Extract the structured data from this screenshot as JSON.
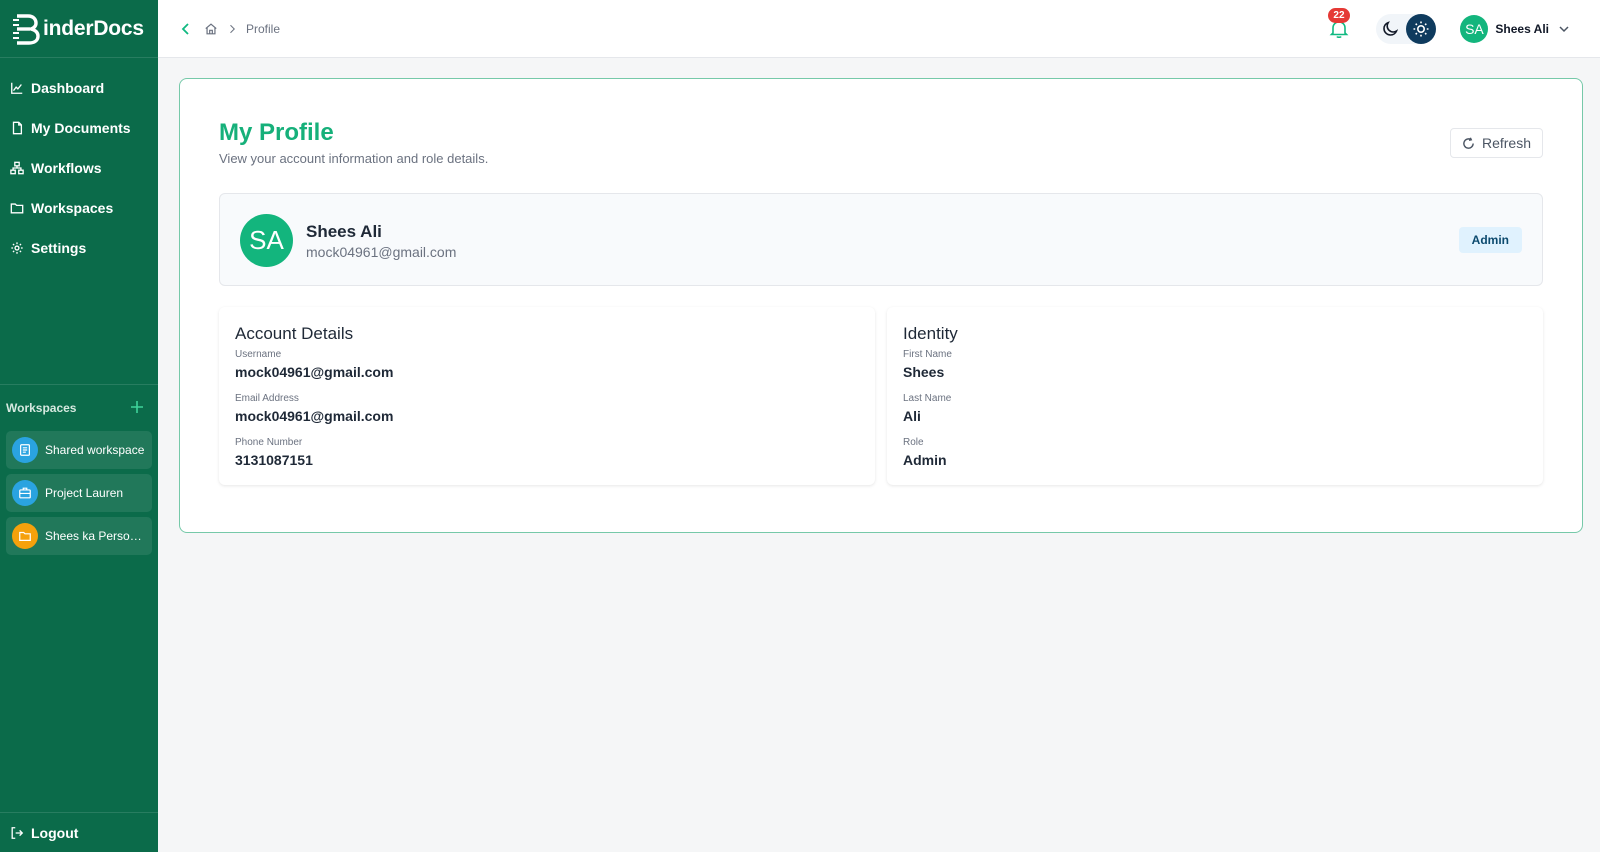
{
  "app": {
    "logo_letter": "B",
    "logo_text": "inderDocs"
  },
  "sidebar": {
    "nav": [
      {
        "label": "Dashboard",
        "icon": "chart-line-icon"
      },
      {
        "label": "My Documents",
        "icon": "file-icon"
      },
      {
        "label": "Workflows",
        "icon": "workflow-icon"
      },
      {
        "label": "Workspaces",
        "icon": "folder-icon"
      },
      {
        "label": "Settings",
        "icon": "gear-icon"
      }
    ],
    "workspaces_title": "Workspaces",
    "workspaces": [
      {
        "label": "Shared workspace",
        "color": "#2aa3e0"
      },
      {
        "label": "Project Lauren",
        "color": "#2aa3e0"
      },
      {
        "label": "Shees ka Personal",
        "color": "#f5a10c"
      }
    ],
    "logout_label": "Logout"
  },
  "header": {
    "breadcrumb_current": "Profile",
    "notification_count": "22",
    "user_initials": "SA",
    "user_name": "Shees Ali"
  },
  "profile": {
    "title": "My Profile",
    "subtitle": "View your account information and role details.",
    "refresh_label": "Refresh",
    "initials": "SA",
    "name": "Shees Ali",
    "email": "mock04961@gmail.com",
    "role_badge": "Admin"
  },
  "account_details": {
    "title": "Account Details",
    "username_label": "Username",
    "username": "mock04961@gmail.com",
    "email_label": "Email Address",
    "email": "mock04961@gmail.com",
    "phone_label": "Phone Number",
    "phone": "3131087151"
  },
  "identity": {
    "title": "Identity",
    "first_name_label": "First Name",
    "first_name": "Shees",
    "last_name_label": "Last Name",
    "last_name": "Ali",
    "role_label": "Role",
    "role": "Admin"
  },
  "colors": {
    "sidebar_bg": "#0b6b4a",
    "accent": "#16b07a",
    "badge_red": "#e53935",
    "theme_active": "#0f3b5e"
  }
}
